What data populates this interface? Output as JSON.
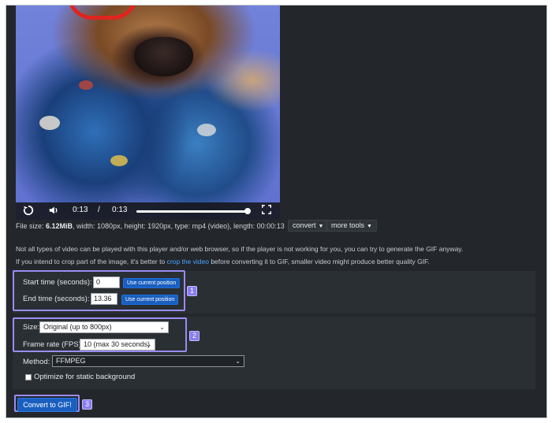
{
  "video": {
    "current_time": "0:13",
    "separator": "/",
    "duration": "0:13",
    "progress_fraction": 0.99
  },
  "file_info": {
    "prefix": "File size: ",
    "size": "6.12MiB",
    "details": ", width: 1080px, height: 1920px, type: mp4 (video), length: 00:00:13"
  },
  "buttons": {
    "convert_menu": "convert",
    "more_tools_menu": "more tools",
    "use_current_position_start": "Use current position",
    "use_current_position_end": "Use current position",
    "convert_to_gif": "Convert to GIF!"
  },
  "notes": {
    "line1": "Not all types of video can be played with this player and/or web browser, so if the player is not working for you, you can try to generate the GIF anyway.",
    "line2_before": "If you intend to crop part of the image, it's better to ",
    "line2_link": "crop the video",
    "line2_after": " before converting it to GIF, smaller video might produce better quality GIF."
  },
  "form": {
    "start_time_label": "Start time (seconds):",
    "start_time_value": "0",
    "end_time_label": "End time (seconds):",
    "end_time_value": "13.36",
    "size_label": "Size:",
    "size_value": "Original (up to 800px)",
    "frame_rate_label": "Frame rate (FPS):",
    "frame_rate_value": "10 (max 30 seconds)",
    "method_label": "Method:",
    "method_value": "FFMPEG",
    "optimize_label": "Optimize for static background",
    "optimize_checked": false
  },
  "badges": [
    "1",
    "2",
    "3"
  ],
  "colors": {
    "panel_bg": "#23272b",
    "primary_button": "#1a5fbf",
    "link": "#4aa3ff",
    "highlight": "#9b8cf5"
  },
  "icons": {
    "replay": "replay-icon",
    "volume": "volume-icon",
    "fullscreen": "fullscreen-icon"
  }
}
